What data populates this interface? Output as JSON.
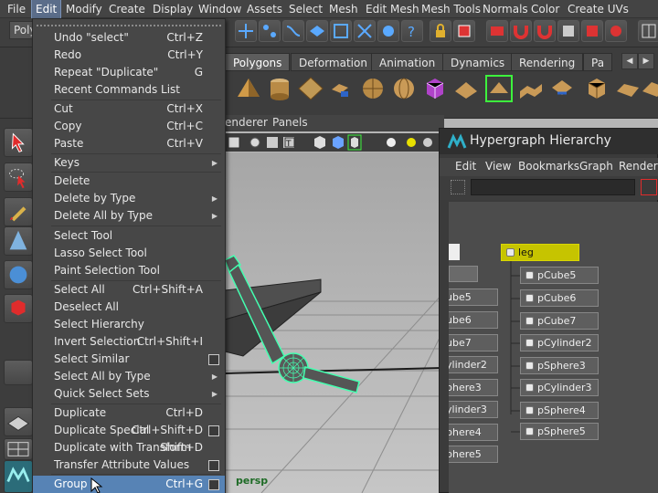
{
  "menubar": {
    "items": [
      {
        "label": "File"
      },
      {
        "label": "Edit"
      },
      {
        "label": "Modify"
      },
      {
        "label": "Create"
      },
      {
        "label": "Display"
      },
      {
        "label": "Window"
      },
      {
        "label": "Assets"
      },
      {
        "label": "Select"
      },
      {
        "label": "Mesh"
      },
      {
        "label": "Edit Mesh"
      },
      {
        "label": "Mesh Tools"
      },
      {
        "label": "Normals"
      },
      {
        "label": "Color"
      },
      {
        "label": "Create UVs"
      }
    ]
  },
  "statusline": {
    "mode_label": "Poly"
  },
  "shelf": {
    "tabs": [
      {
        "label": "Polygons"
      },
      {
        "label": "Deformation"
      },
      {
        "label": "Animation"
      },
      {
        "label": "Dynamics"
      },
      {
        "label": "Rendering"
      },
      {
        "label": "Pa"
      }
    ],
    "selected_tab": "Polygons"
  },
  "viewport": {
    "menu": {
      "renderer": "enderer",
      "panels": "Panels"
    },
    "camera_label": "persp",
    "wire_color": "#44ffb0"
  },
  "edit_menu": {
    "items": [
      {
        "label": "Undo \"select\"",
        "shortcut": "Ctrl+Z"
      },
      {
        "label": "Redo",
        "shortcut": "Ctrl+Y"
      },
      {
        "label": "Repeat \"Duplicate\"",
        "shortcut": "G"
      },
      {
        "label": "Recent Commands List",
        "shortcut": ""
      },
      {
        "label": "Cut",
        "shortcut": "Ctrl+X"
      },
      {
        "label": "Copy",
        "shortcut": "Ctrl+C"
      },
      {
        "label": "Paste",
        "shortcut": "Ctrl+V"
      },
      {
        "label": "Keys",
        "shortcut": "",
        "submenu": true
      },
      {
        "label": "Delete",
        "shortcut": ""
      },
      {
        "label": "Delete by Type",
        "shortcut": "",
        "submenu": true
      },
      {
        "label": "Delete All by Type",
        "shortcut": "",
        "submenu": true
      },
      {
        "label": "Select Tool",
        "shortcut": ""
      },
      {
        "label": "Lasso Select Tool",
        "shortcut": ""
      },
      {
        "label": "Paint Selection Tool",
        "shortcut": ""
      },
      {
        "label": "Select All",
        "shortcut": "Ctrl+Shift+A"
      },
      {
        "label": "Deselect All",
        "shortcut": ""
      },
      {
        "label": "Select Hierarchy",
        "shortcut": ""
      },
      {
        "label": "Invert Selection",
        "shortcut": "Ctrl+Shift+I"
      },
      {
        "label": "Select Similar",
        "shortcut": "",
        "option_box": true
      },
      {
        "label": "Select All by Type",
        "shortcut": "",
        "submenu": true
      },
      {
        "label": "Quick Select Sets",
        "shortcut": "",
        "submenu": true
      },
      {
        "label": "Duplicate",
        "shortcut": "Ctrl+D"
      },
      {
        "label": "Duplicate Special",
        "shortcut": "Ctrl+Shift+D",
        "option_box": true
      },
      {
        "label": "Duplicate with Transform",
        "shortcut": "Shift+D"
      },
      {
        "label": "Transfer Attribute Values",
        "shortcut": "",
        "option_box": true
      },
      {
        "label": "Group",
        "shortcut": "Ctrl+G",
        "option_box": true,
        "highlighted": true
      }
    ]
  },
  "hypergraph": {
    "title": "Hypergraph Hierarchy",
    "menu": [
      {
        "label": "Edit"
      },
      {
        "label": "View"
      },
      {
        "label": "Bookmarks"
      },
      {
        "label": "Graph"
      },
      {
        "label": "Renderin"
      }
    ],
    "leg_node": "leg",
    "left_nodes": [
      {
        "label": "ube5"
      },
      {
        "label": "ube6"
      },
      {
        "label": "ube7"
      },
      {
        "label": "ylinder2"
      },
      {
        "label": "phere3"
      },
      {
        "label": "ylinder3"
      },
      {
        "label": "phere4"
      },
      {
        "label": "phere5"
      }
    ],
    "child_nodes": [
      {
        "label": "pCube5"
      },
      {
        "label": "pCube6"
      },
      {
        "label": "pCube7"
      },
      {
        "label": "pCylinder2"
      },
      {
        "label": "pSphere3"
      },
      {
        "label": "pCylinder3"
      },
      {
        "label": "pSphere4"
      },
      {
        "label": "pSphere5"
      }
    ],
    "leg_color": "#c6c400"
  }
}
